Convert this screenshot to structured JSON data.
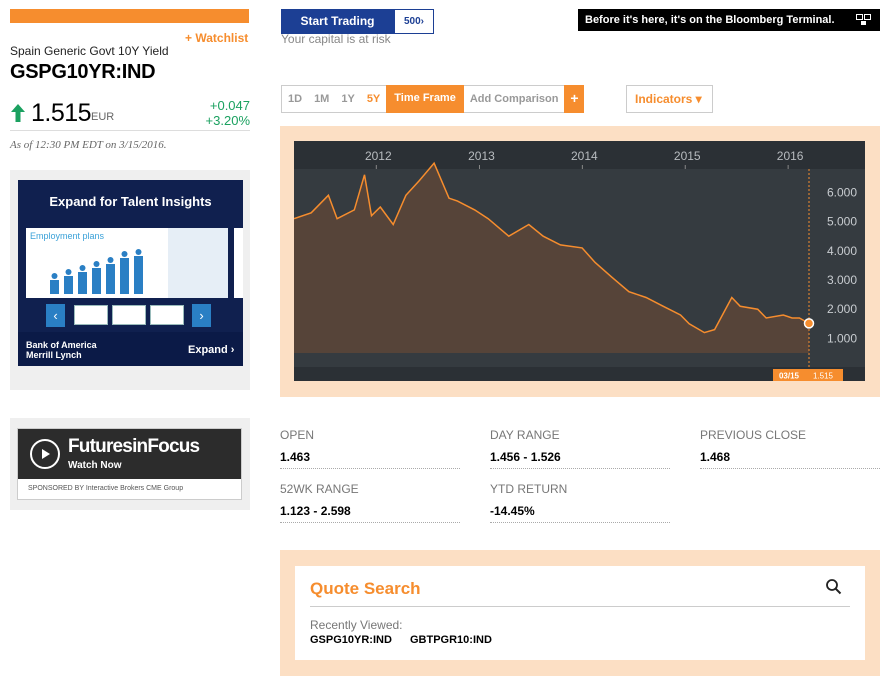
{
  "security": {
    "watchlist_label": "+ Watchlist",
    "name": "Spain Generic Govt 10Y Yield",
    "ticker": "GSPG10YR:IND",
    "price": "1.515",
    "currency": "EUR",
    "change": "+0.047",
    "change_pct": "+3.20%",
    "as_of": "As of 12:30 PM EDT on 3/15/2016.",
    "up_color": "#1ba160"
  },
  "ads": {
    "talent": {
      "title": "Expand for Talent Insights",
      "panel_heading": "Employment plans",
      "brand": "Bank of America\nMerrill Lynch",
      "expand": "Expand ›"
    },
    "futures": {
      "title": "FuturesinFocus",
      "watch": "Watch Now",
      "sponsors": "SPONSORED BY   Interactive Brokers   CME Group"
    }
  },
  "top": {
    "start_trading": "Start Trading",
    "s500_label": "500›",
    "capital_risk": "Your capital is at risk",
    "bloomberg_banner": "Before it's here, it's on the Bloomberg Terminal."
  },
  "toolbar": {
    "timeframes": [
      "1D",
      "1M",
      "1Y",
      "5Y"
    ],
    "active_timeframe": "5Y",
    "time_frame_label": "Time Frame",
    "add_comparison": "Add Comparison",
    "plus": "+",
    "indicators": "Indicators ▾"
  },
  "chart_data": {
    "type": "area",
    "x_years": [
      "2012",
      "2013",
      "2014",
      "2015",
      "2016"
    ],
    "y_ticks": [
      "6.000",
      "5.000",
      "4.000",
      "3.000",
      "2.000",
      "1.000"
    ],
    "ylim": [
      0.5,
      6.8
    ],
    "x_range": [
      "2011-03-15",
      "2016-03-15"
    ],
    "last_date_label": "03/15",
    "last_value_label": "1.515",
    "series": [
      {
        "values": [
          [
            "2011-03-15",
            5.1
          ],
          [
            "2011-05-15",
            5.3
          ],
          [
            "2011-07-15",
            5.9
          ],
          [
            "2011-08-15",
            5.1
          ],
          [
            "2011-10-15",
            5.4
          ],
          [
            "2011-11-20",
            6.6
          ],
          [
            "2011-12-15",
            5.2
          ],
          [
            "2012-01-15",
            5.5
          ],
          [
            "2012-03-01",
            4.9
          ],
          [
            "2012-04-15",
            5.9
          ],
          [
            "2012-06-01",
            6.4
          ],
          [
            "2012-07-24",
            7.0
          ],
          [
            "2012-09-15",
            5.8
          ],
          [
            "2012-10-15",
            5.7
          ],
          [
            "2012-12-15",
            5.4
          ],
          [
            "2013-02-01",
            5.1
          ],
          [
            "2013-04-15",
            4.5
          ],
          [
            "2013-06-25",
            4.9
          ],
          [
            "2013-08-15",
            4.5
          ],
          [
            "2013-10-15",
            4.2
          ],
          [
            "2013-12-31",
            4.1
          ],
          [
            "2014-02-15",
            3.6
          ],
          [
            "2014-04-15",
            3.1
          ],
          [
            "2014-06-15",
            2.6
          ],
          [
            "2014-08-15",
            2.4
          ],
          [
            "2014-10-15",
            2.1
          ],
          [
            "2014-12-15",
            1.8
          ],
          [
            "2015-01-15",
            1.5
          ],
          [
            "2015-03-10",
            1.2
          ],
          [
            "2015-04-15",
            1.3
          ],
          [
            "2015-06-15",
            2.4
          ],
          [
            "2015-07-15",
            2.1
          ],
          [
            "2015-09-15",
            2.0
          ],
          [
            "2015-10-15",
            1.7
          ],
          [
            "2015-12-15",
            1.8
          ],
          [
            "2016-01-15",
            1.7
          ],
          [
            "2016-02-10",
            1.7
          ],
          [
            "2016-03-15",
            1.515
          ]
        ]
      }
    ],
    "colors": {
      "line": "#f68d2e",
      "fill": "#5a4638",
      "background": "#353b40"
    }
  },
  "stats": [
    {
      "label": "OPEN",
      "value": "1.463"
    },
    {
      "label": "DAY RANGE",
      "value": "1.456 - 1.526"
    },
    {
      "label": "PREVIOUS CLOSE",
      "value": "1.468"
    },
    {
      "label": "52WK RANGE",
      "value": "1.123 - 2.598"
    },
    {
      "label": "YTD RETURN",
      "value": "-14.45%"
    }
  ],
  "quote_search": {
    "title": "Quote Search",
    "recently_viewed": "Recently Viewed:",
    "recent": [
      "GSPG10YR:IND",
      "GBTPGR10:IND"
    ]
  }
}
